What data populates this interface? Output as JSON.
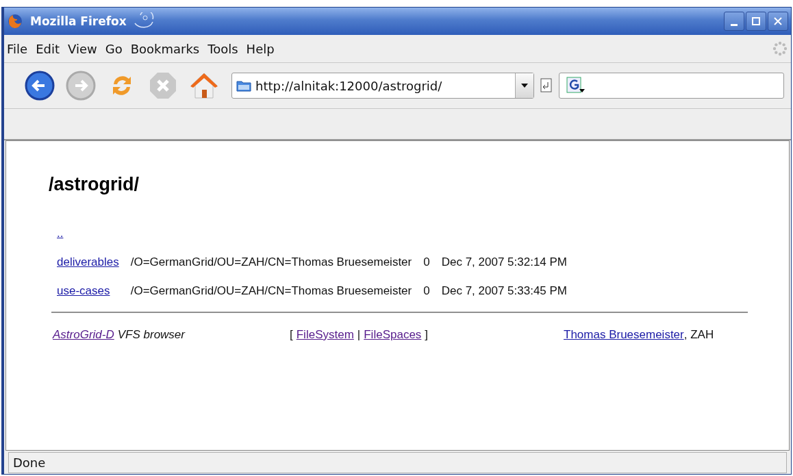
{
  "window": {
    "title": "Mozilla Firefox"
  },
  "menu": [
    "File",
    "Edit",
    "View",
    "Go",
    "Bookmarks",
    "Tools",
    "Help"
  ],
  "toolbar": {
    "back": {
      "disabled": false
    },
    "forward": {
      "disabled": true
    },
    "stop": {
      "disabled": true
    },
    "address": "http://alnitak:12000/astrogrid/"
  },
  "page": {
    "heading": "/astrogrid/",
    "parent_link": {
      "text": "..",
      "visited": false
    },
    "rows": [
      {
        "name": "deliverables",
        "visited": false,
        "owner": "/O=GermanGrid/OU=ZAH/CN=Thomas Bruesemeister",
        "size": "0",
        "date": "Dec 7, 2007 5:32:14 PM"
      },
      {
        "name": "use-cases",
        "visited": false,
        "owner": "/O=GermanGrid/OU=ZAH/CN=Thomas Bruesemeister",
        "size": "0",
        "date": "Dec 7, 2007 5:33:45 PM"
      }
    ],
    "footer": {
      "left": {
        "link": {
          "text": "AstroGrid-D",
          "visited": true
        },
        "text": "VFS browser"
      },
      "center": {
        "open": "[",
        "links": [
          {
            "text": "FileSystem",
            "visited": true
          },
          {
            "text": "FileSpaces",
            "visited": true
          }
        ],
        "separator": "|",
        "close": "]"
      },
      "right": {
        "link": {
          "text": "Thomas Bruesemeister",
          "visited": false
        },
        "text": ", ZAH"
      }
    }
  },
  "status_bar": "Done"
}
